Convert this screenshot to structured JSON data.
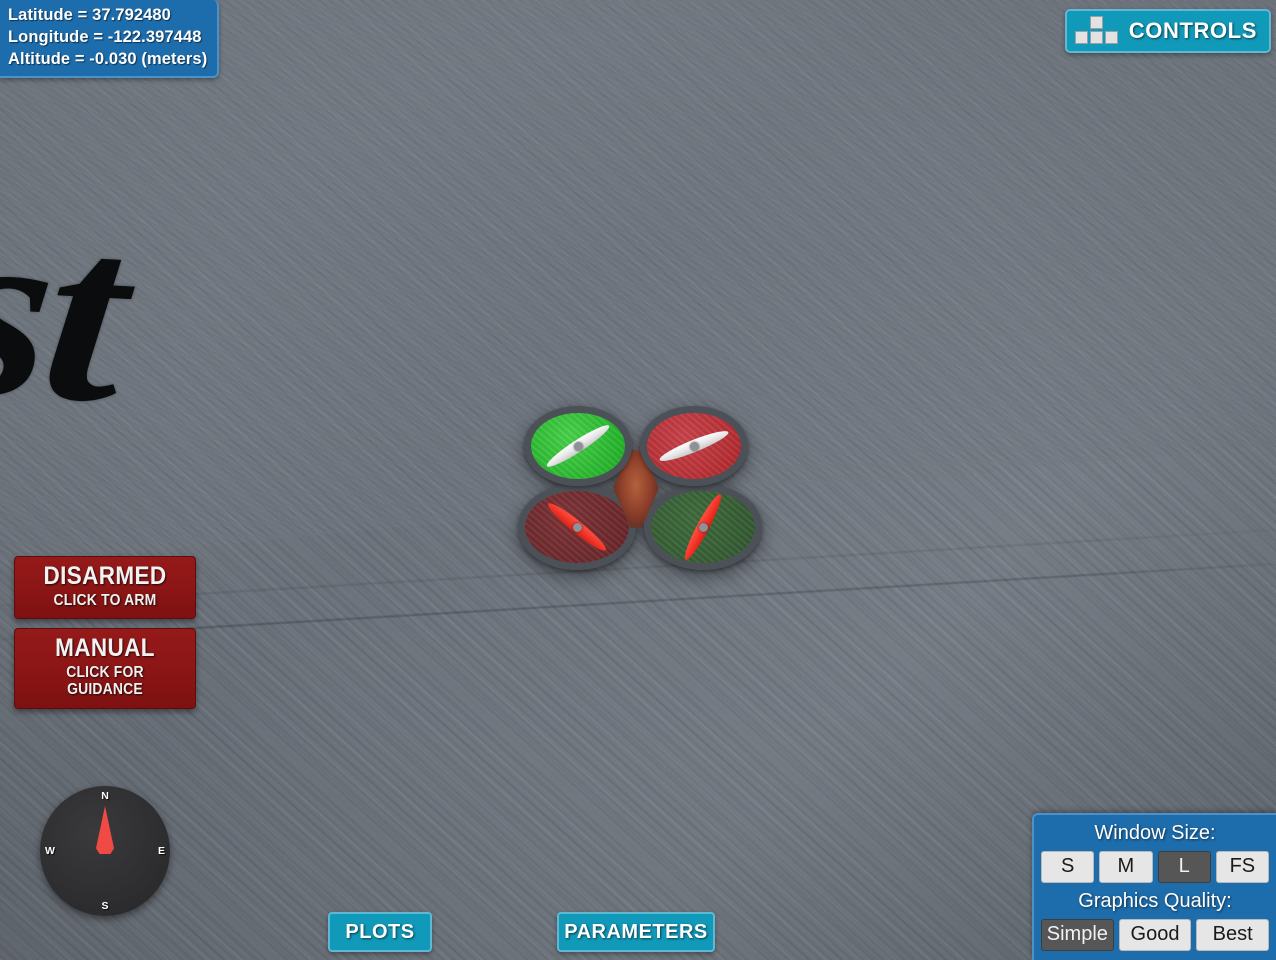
{
  "gps": {
    "latitude_line": "Latitude = 37.792480",
    "longitude_line": "Longitude = -122.397448",
    "altitude_line": "Altitude = -0.030 (meters)"
  },
  "controls": {
    "label": "CONTROLS",
    "icon": "wasd-keys-icon"
  },
  "status": {
    "arm": {
      "main": "DISARMED",
      "sub": "CLICK TO ARM"
    },
    "mode": {
      "main": "MANUAL",
      "sub": "CLICK FOR GUIDANCE"
    }
  },
  "compass": {
    "north": "N",
    "east": "E",
    "south": "S",
    "west": "W",
    "heading_deg": 0
  },
  "nav": {
    "plots": "PLOTS",
    "parameters": "PARAMETERS"
  },
  "settings": {
    "window_size_label": "Window Size:",
    "window_size_options": [
      "S",
      "M",
      "L",
      "FS"
    ],
    "window_size_selected": "L",
    "graphics_label": "Graphics Quality:",
    "graphics_options": [
      "Simple",
      "Good",
      "Best"
    ],
    "graphics_selected": "Simple"
  },
  "scene": {
    "ground_marking": "st",
    "ground_color": "#6e757e"
  },
  "colors": {
    "accent_teal": "#1199b9",
    "panel_blue": "#1d6cab",
    "alert_red": "#8b1515",
    "needle_red": "#ef4b44",
    "rotor_front_left": "#26b52c",
    "rotor_front_right": "#b52d33",
    "rotor_rear_left": "#6b282c",
    "rotor_rear_right": "#355c33"
  }
}
